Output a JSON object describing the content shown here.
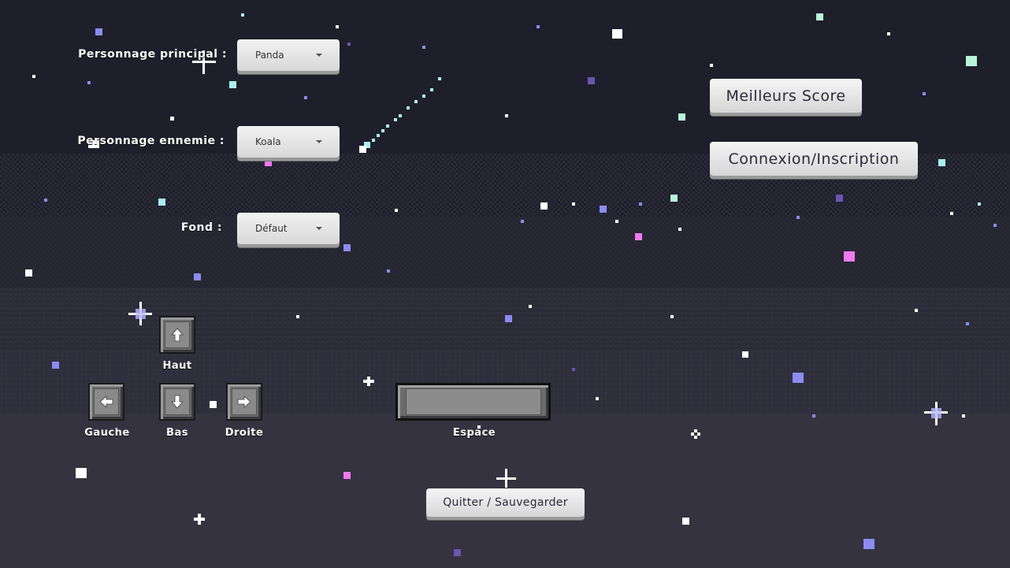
{
  "settings": {
    "main_character": {
      "label": "Personnage principal :",
      "value": "Panda"
    },
    "enemy_character": {
      "label": "Personnage ennemie :",
      "value": "Koala"
    },
    "background": {
      "label": "Fond :",
      "value": "Défaut"
    }
  },
  "buttons": {
    "best_scores": "Meilleurs Score",
    "login": "Connexion/Inscription",
    "quit_save": "Quitter / Sauvegarder"
  },
  "controls": {
    "up": "Haut",
    "left": "Gauche",
    "down": "Bas",
    "right": "Droite",
    "space": "Espace"
  },
  "colors": {
    "sky_top": "#1f1f2b",
    "sky_bottom": "#33323f",
    "star_white": "#ffffff",
    "star_blue": "#8a8cf0",
    "star_cyan": "#a8f0f0",
    "star_mint": "#b8f5d8",
    "star_pink": "#f078f0",
    "star_purple": "#6a55b0"
  },
  "icons": {
    "up": "arrow-up-icon",
    "left": "arrow-left-icon",
    "down": "arrow-down-icon",
    "right": "arrow-right-icon"
  }
}
